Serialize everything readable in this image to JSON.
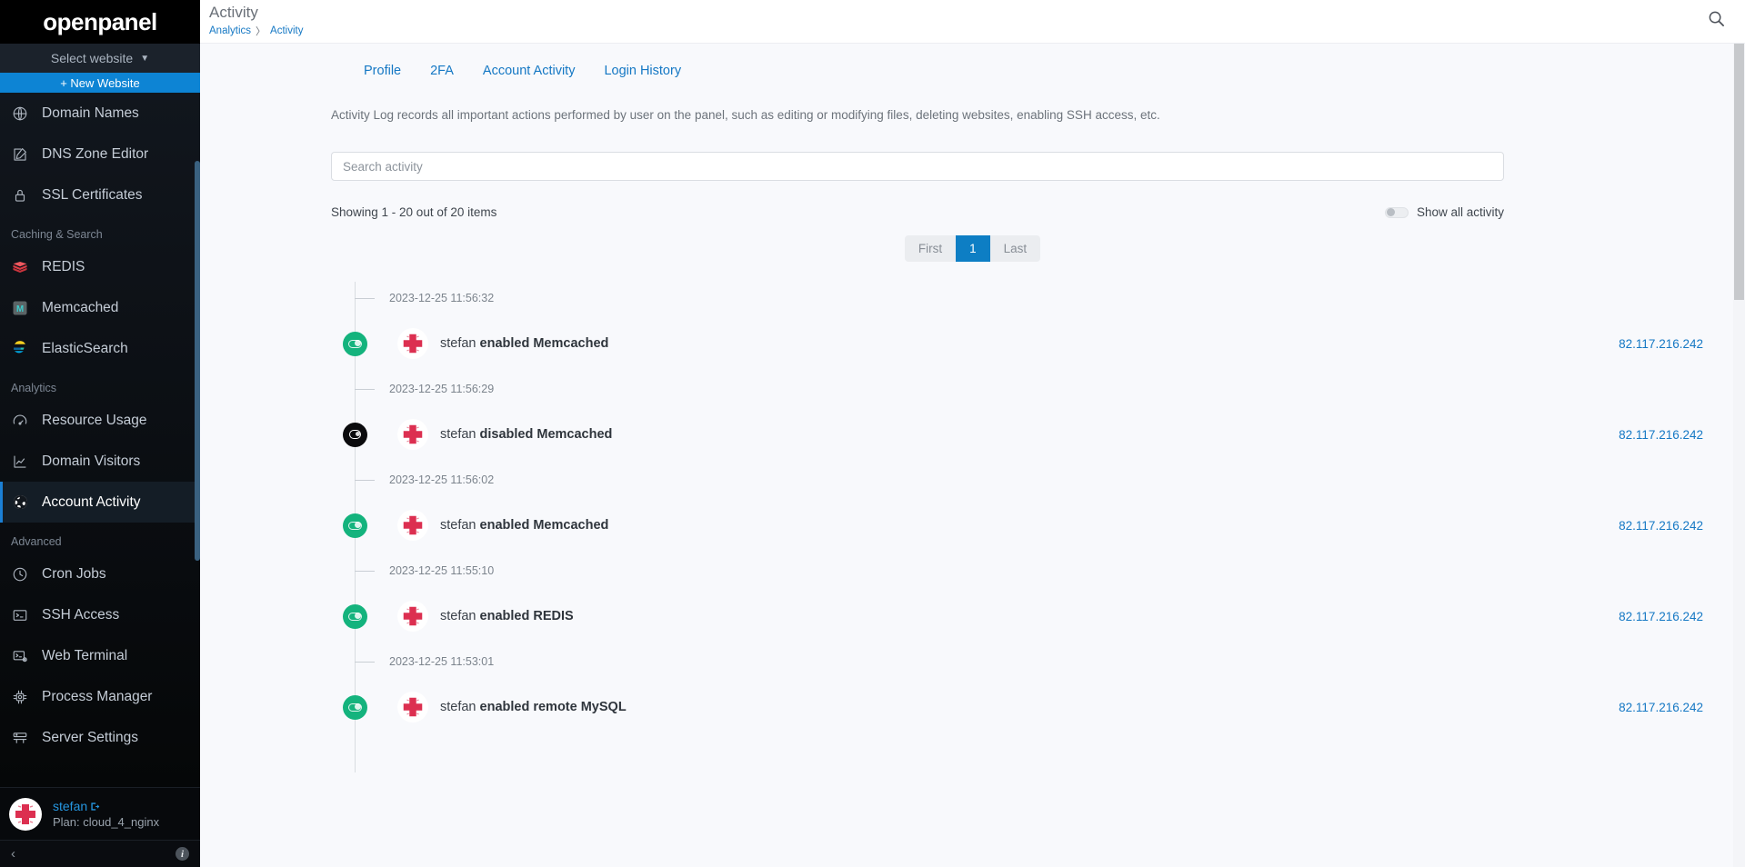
{
  "sidebar": {
    "brand": "openpanel",
    "site_selector": {
      "label": "Select website",
      "icon": "chevron-down-icon"
    },
    "new_website_button": "+ New Website",
    "nav": [
      {
        "label": "Domain Names",
        "icon": "globe-icon",
        "type": "item",
        "active": false
      },
      {
        "label": "DNS Zone Editor",
        "icon": "edit-square-icon",
        "type": "item",
        "active": false
      },
      {
        "label": "SSL Certificates",
        "icon": "lock-icon",
        "type": "item",
        "active": false
      },
      {
        "label": "Caching & Search",
        "icon": "",
        "type": "section",
        "active": false
      },
      {
        "label": "REDIS",
        "icon": "redis-icon",
        "type": "item",
        "active": false
      },
      {
        "label": "Memcached",
        "icon": "memcached-icon",
        "type": "item",
        "active": false
      },
      {
        "label": "ElasticSearch",
        "icon": "elasticsearch-icon",
        "type": "item",
        "active": false
      },
      {
        "label": "Analytics",
        "icon": "",
        "type": "section",
        "active": false
      },
      {
        "label": "Resource Usage",
        "icon": "gauge-icon",
        "type": "item",
        "active": false
      },
      {
        "label": "Domain Visitors",
        "icon": "line-chart-icon",
        "type": "item",
        "active": false
      },
      {
        "label": "Account Activity",
        "icon": "globe-filled-icon",
        "type": "item",
        "active": true
      },
      {
        "label": "Advanced",
        "icon": "",
        "type": "section",
        "active": false
      },
      {
        "label": "Cron Jobs",
        "icon": "clock-icon",
        "type": "item",
        "active": false
      },
      {
        "label": "SSH Access",
        "icon": "terminal-icon",
        "type": "item",
        "active": false
      },
      {
        "label": "Web Terminal",
        "icon": "web-terminal-icon",
        "type": "item",
        "active": false
      },
      {
        "label": "Process Manager",
        "icon": "cpu-icon",
        "type": "item",
        "active": false
      },
      {
        "label": "Server Settings",
        "icon": "server-icon",
        "type": "item",
        "active": false
      }
    ],
    "user": {
      "name": "stefan",
      "logout_icon": "logout-icon",
      "plan": "Plan: cloud_4_nginx",
      "avatar_icon": "user-avatar-icon"
    },
    "footer": {
      "collapse_icon": "chevron-left-icon",
      "info_icon": "info-icon",
      "info_label": "i"
    }
  },
  "header": {
    "title": "Activity",
    "breadcrumb": [
      "Analytics",
      "Activity"
    ],
    "breadcrumb_separator": "〉",
    "search_icon": "search-icon"
  },
  "tabs": [
    {
      "label": "Profile"
    },
    {
      "label": "2FA"
    },
    {
      "label": "Account Activity"
    },
    {
      "label": "Login History"
    }
  ],
  "intro": "Activity Log records all important actions performed by user on the panel, such as editing or modifying files, deleting websites, enabling SSH access, etc.",
  "search": {
    "placeholder": "Search activity",
    "value": ""
  },
  "showing": "Showing 1 - 20 out of 20 items",
  "show_all": {
    "label": "Show all activity",
    "enabled": false
  },
  "pagination": {
    "first": "First",
    "current": "1",
    "last": "Last"
  },
  "colors": {
    "accent_blue": "#0d7ec4",
    "link_blue": "#1578c4",
    "enabled_green": "#14b37d",
    "disabled_black": "#0b0b0d",
    "avatar_red": "#dc2f50",
    "sidebar_bg": "#0d1117"
  },
  "activity": [
    {
      "time": "2023-12-25 11:56:32",
      "user": "stefan",
      "action": "enabled Memcached",
      "state": "on",
      "ip": "82.117.216.242"
    },
    {
      "time": "2023-12-25 11:56:29",
      "user": "stefan",
      "action": "disabled Memcached",
      "state": "off",
      "ip": "82.117.216.242"
    },
    {
      "time": "2023-12-25 11:56:02",
      "user": "stefan",
      "action": "enabled Memcached",
      "state": "on",
      "ip": "82.117.216.242"
    },
    {
      "time": "2023-12-25 11:55:10",
      "user": "stefan",
      "action": "enabled REDIS",
      "state": "on",
      "ip": "82.117.216.242"
    },
    {
      "time": "2023-12-25 11:53:01",
      "user": "stefan",
      "action": "enabled remote MySQL",
      "state": "on",
      "ip": "82.117.216.242"
    }
  ]
}
